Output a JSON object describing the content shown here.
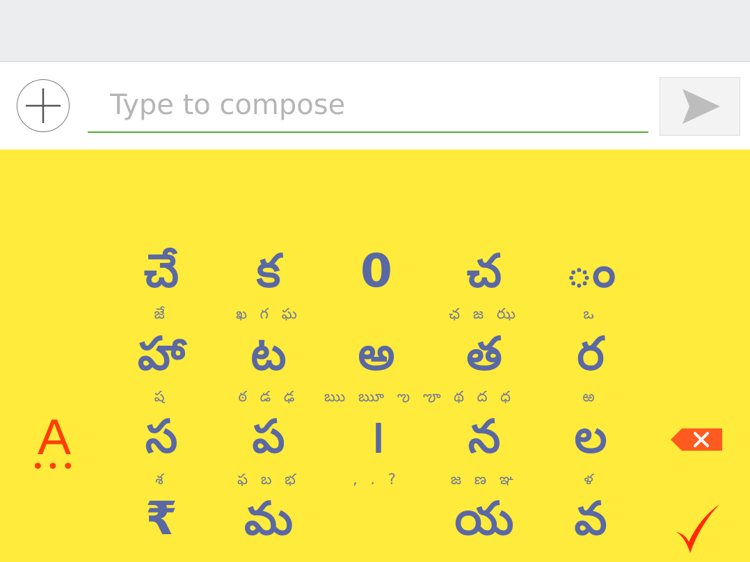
{
  "compose": {
    "placeholder": "Type to compose",
    "value": ""
  },
  "icons": {
    "add": "plus-icon",
    "send": "send-arrow-icon",
    "backspace": "backspace-icon",
    "done": "checkmark-icon"
  },
  "colors": {
    "keyboard_bg": "#ffeb3b",
    "key_text": "#5a68a4",
    "accent": "#ff3d00",
    "input_underline": "#4caf2e"
  },
  "keyboard": {
    "mode_key": {
      "label": "A",
      "dots": "•••"
    },
    "rows": [
      [
        {
          "main": "చే",
          "sub": "జే"
        },
        {
          "main": "క",
          "sub": "ఖ గ ఘ"
        },
        {
          "main": "0",
          "sub": ""
        },
        {
          "main": "చ",
          "sub": "ఛ జ ఝ"
        },
        {
          "main": "◌ం",
          "sub": "ఒ"
        }
      ],
      [
        {
          "main": "హా",
          "sub": "ష"
        },
        {
          "main": "ట",
          "sub": "ఠ డ ఢ"
        },
        {
          "main": "అ",
          "sub": "ఋ ౠ ఌ ౡ"
        },
        {
          "main": "త",
          "sub": "థ ద ధ"
        },
        {
          "main": "ర",
          "sub": "ఱ"
        }
      ],
      [
        {
          "main": "స",
          "sub": "శ"
        },
        {
          "main": "ప",
          "sub": "ఫ బ భ"
        },
        {
          "main": "।",
          "sub": ", . ?"
        },
        {
          "main": "న",
          "sub": "జ ణ ఞ"
        },
        {
          "main": "ల",
          "sub": "ళ"
        }
      ],
      [
        {
          "main": "₹",
          "sub": ""
        },
        {
          "main": "మ",
          "sub": ""
        },
        {
          "main": "",
          "sub": ""
        },
        {
          "main": "య",
          "sub": ""
        },
        {
          "main": "వ",
          "sub": ""
        }
      ]
    ]
  }
}
